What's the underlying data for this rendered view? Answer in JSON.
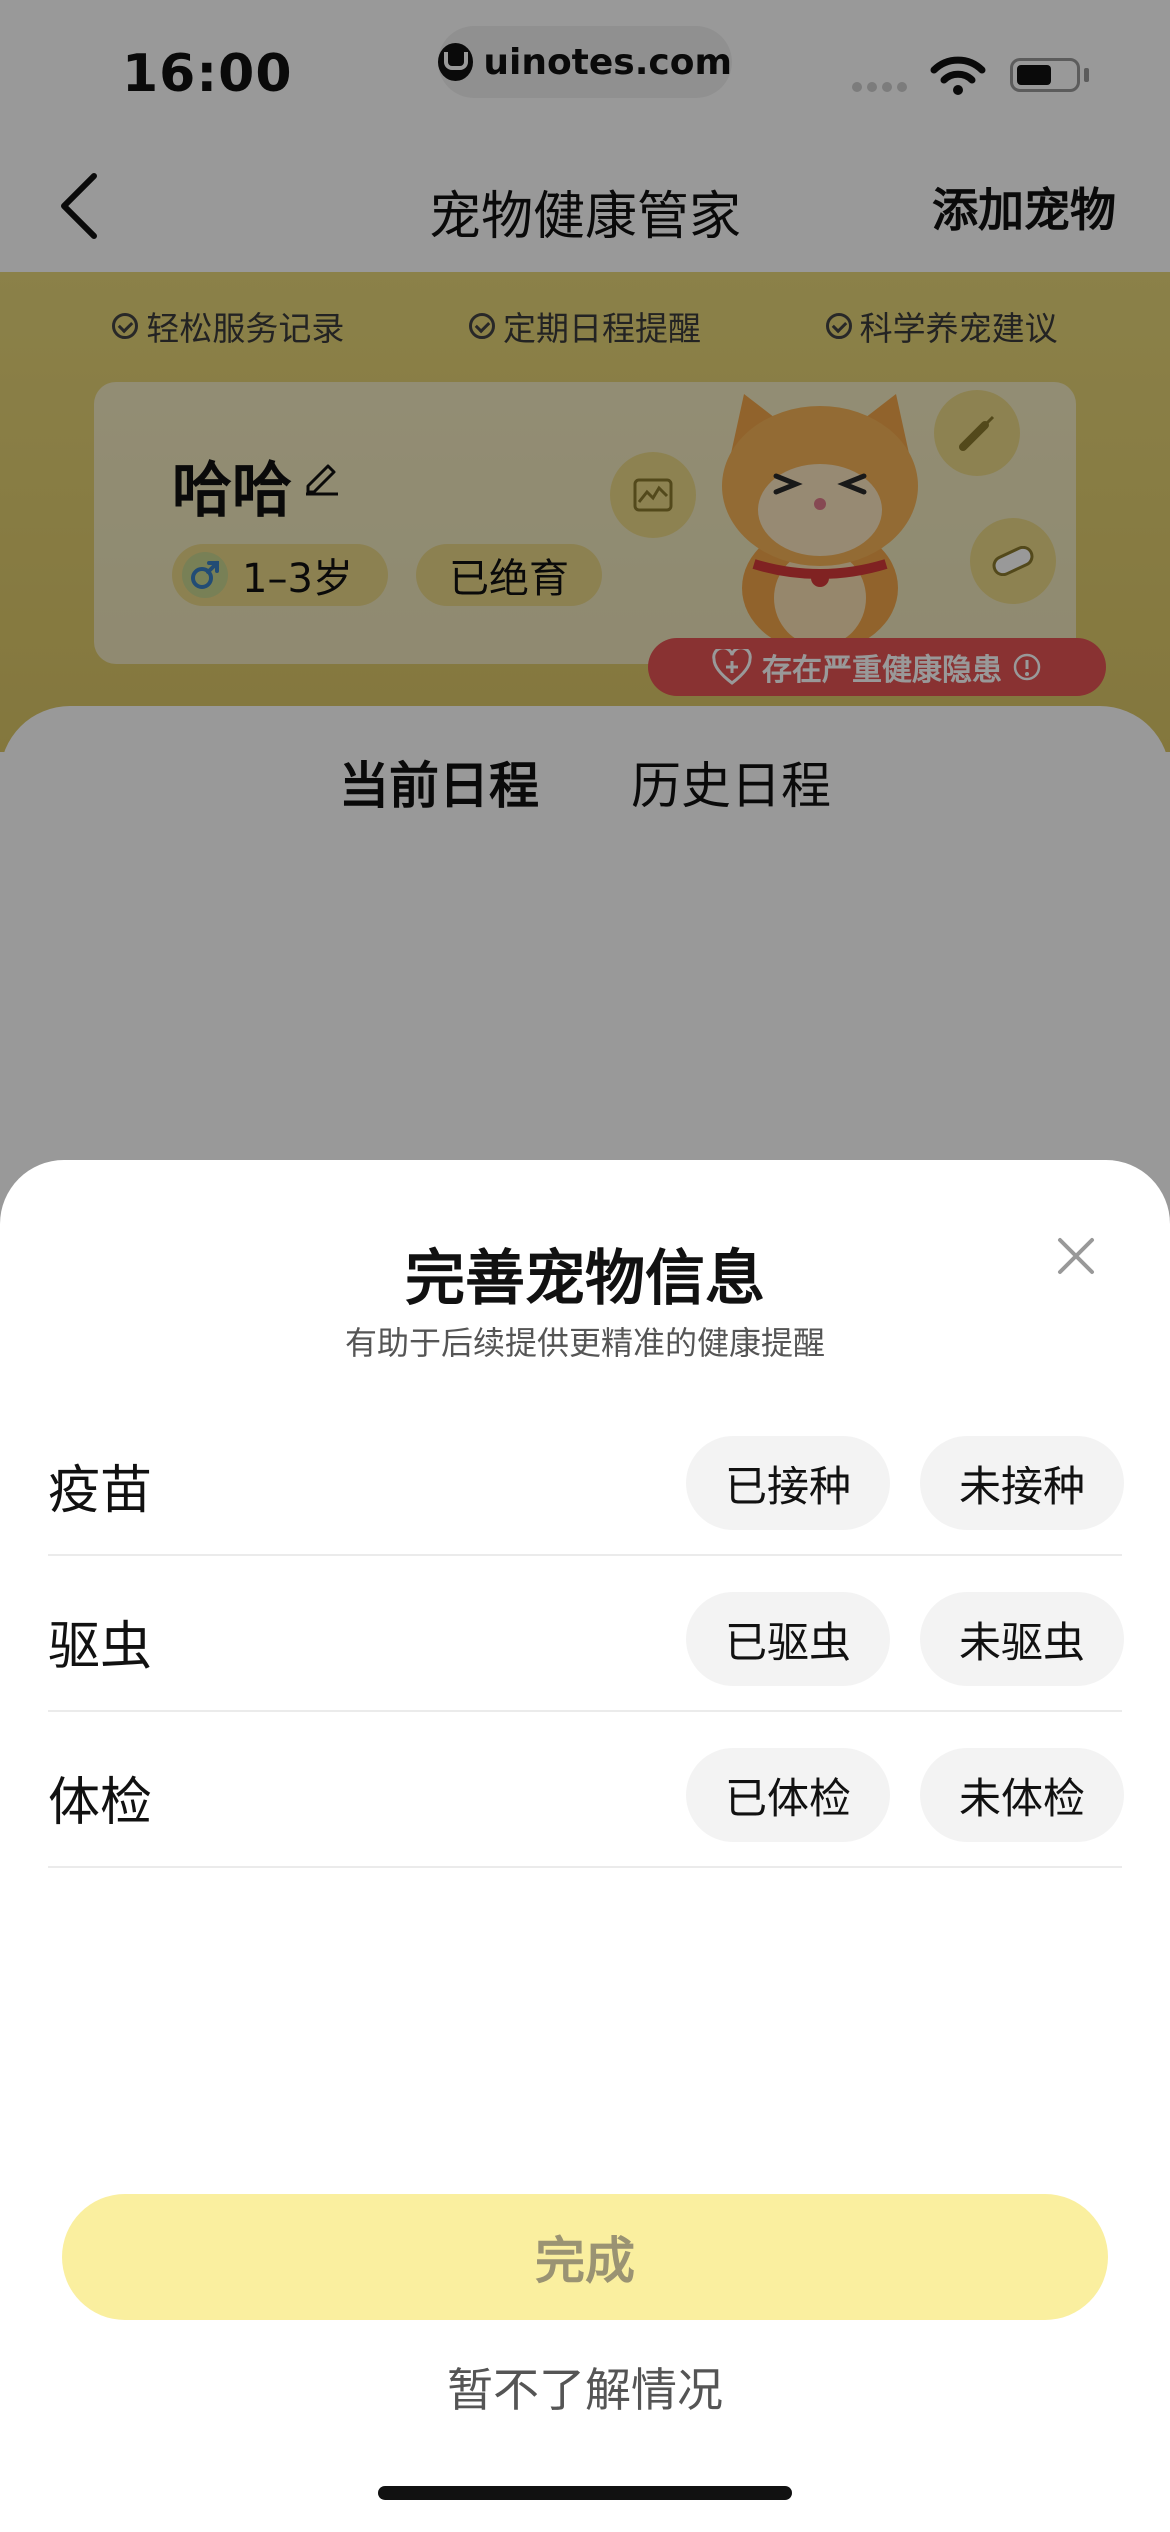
{
  "status_bar": {
    "time": "16:00",
    "url": "uinotes.com"
  },
  "nav": {
    "title": "宠物健康管家",
    "add_pet": "添加宠物"
  },
  "features": [
    "轻松服务记录",
    "定期日程提醒",
    "科学养宠建议"
  ],
  "pet": {
    "name": "哈哈",
    "age": "1–3岁",
    "neutered": "已绝育",
    "warning": "存在严重健康隐患"
  },
  "tabs": {
    "current": "当前日程",
    "history": "历史日程"
  },
  "sheet": {
    "title": "完善宠物信息",
    "subtitle": "有助于后续提供更精准的健康提醒",
    "rows": [
      {
        "label": "疫苗",
        "yes": "已接种",
        "no": "未接种"
      },
      {
        "label": "驱虫",
        "yes": "已驱虫",
        "no": "未驱虫"
      },
      {
        "label": "体检",
        "yes": "已体检",
        "no": "未体检"
      }
    ],
    "done": "完成",
    "skip": "暂不了解情况"
  }
}
